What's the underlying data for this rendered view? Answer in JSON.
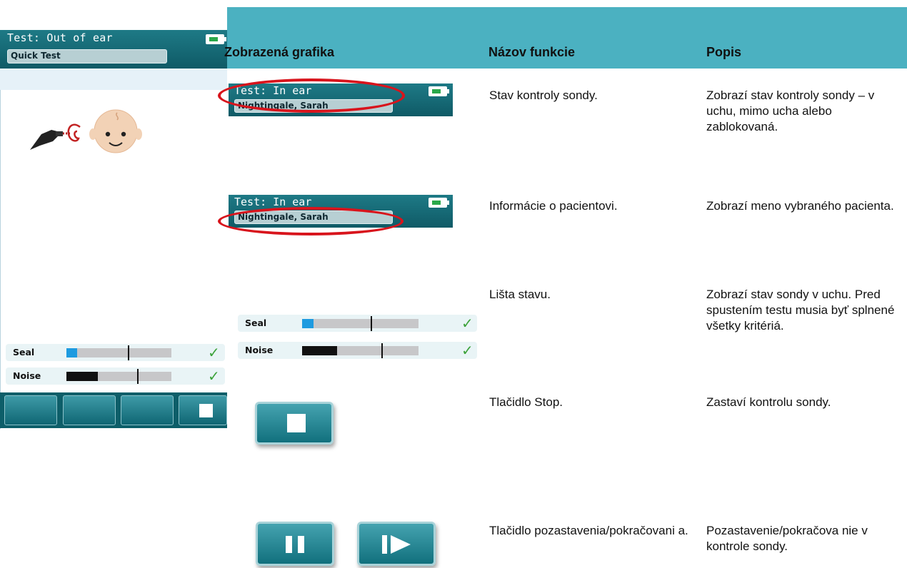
{
  "device": {
    "test_status": "Test: Out of ear",
    "patient_field": "Quick Test",
    "seal_label": "Seal",
    "noise_label": "Noise",
    "check": "✓"
  },
  "table": {
    "headers": [
      "Zobrazená grafika",
      "Názov funkcie",
      "Popis"
    ],
    "rows": [
      {
        "widget_title": "Test: In ear",
        "widget_patient": "Nightingale, Sarah",
        "name": "Stav kontroly sondy.",
        "desc": "Zobrazí stav kontroly sondy – v uchu, mimo ucha alebo zablokovaná."
      },
      {
        "widget_title": "Test: In ear",
        "widget_patient": "Nightingale, Sarah",
        "name": "Informácie o pacientovi.",
        "desc": "Zobrazí meno vybraného pacienta."
      },
      {
        "seal_label": "Seal",
        "noise_label": "Noise",
        "name": "Lišta stavu.",
        "desc": "Zobrazí stav sondy v uchu.  Pred spustením testu musia byť splnené všetky kritériá."
      },
      {
        "name": "Tlačidlo Stop.",
        "desc": "Zastaví kontrolu sondy."
      },
      {
        "name": "Tlačidlo pozastavenia/pokračovani a.",
        "desc": "Pozastavenie/pokračova nie v kontrole sondy."
      }
    ]
  },
  "colors": {
    "header_teal": "#4bb1c1",
    "device_teal": "#0f5a66",
    "highlight_red": "#d8141c",
    "check_green": "#3ca23a",
    "seal_fill": "#1e9be0"
  },
  "levels": {
    "seal_fraction": 0.1,
    "noise_fraction": 0.3
  }
}
